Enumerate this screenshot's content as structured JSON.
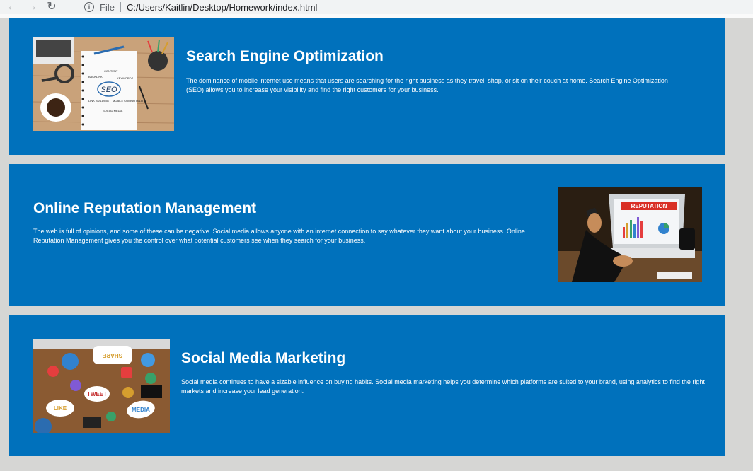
{
  "browser": {
    "back_icon": "arrow-left-icon",
    "forward_icon": "arrow-right-icon",
    "reload_icon": "reload-icon",
    "info_icon": "info-icon",
    "scheme_label": "File",
    "url": "C:/Users/Kaitlin/Desktop/Homework/index.html"
  },
  "sections": [
    {
      "title": "Search Engine Optimization",
      "body": "The dominance of mobile internet use means that users are searching for the right business as they travel, shop, or sit on their couch at home. Search Engine Optimization (SEO) allows you to increase your visibility and find the right customers for your business.",
      "image_text": "SEO",
      "image_words": [
        "CONTENT",
        "BACKLINK",
        "KEYWORDS",
        "LINK BUILDING",
        "MOBILE COMPATIBILITY",
        "SOCIAL MEDIA"
      ]
    },
    {
      "title": "Online Reputation Management",
      "body": "The web is full of opinions, and some of these can be negative. Social media allows anyone with an internet connection to say whatever they want about your business. Online Reputation Management gives you the control over what potential customers see when they search for your business.",
      "image_text": "REPUTATION"
    },
    {
      "title": "Social Media Marketing",
      "body": "Social media continues to have a sizable influence on buying habits. Social media marketing helps you determine which platforms are suited to your brand, using analytics to find the right markets and increase your lead generation.",
      "image_words": [
        "SHARE",
        "TWEET",
        "LIKE",
        "MEDIA"
      ]
    }
  ],
  "colors": {
    "section_bg": "#0071bc",
    "page_bg": "#d6d6d4",
    "text": "#ffffff"
  }
}
